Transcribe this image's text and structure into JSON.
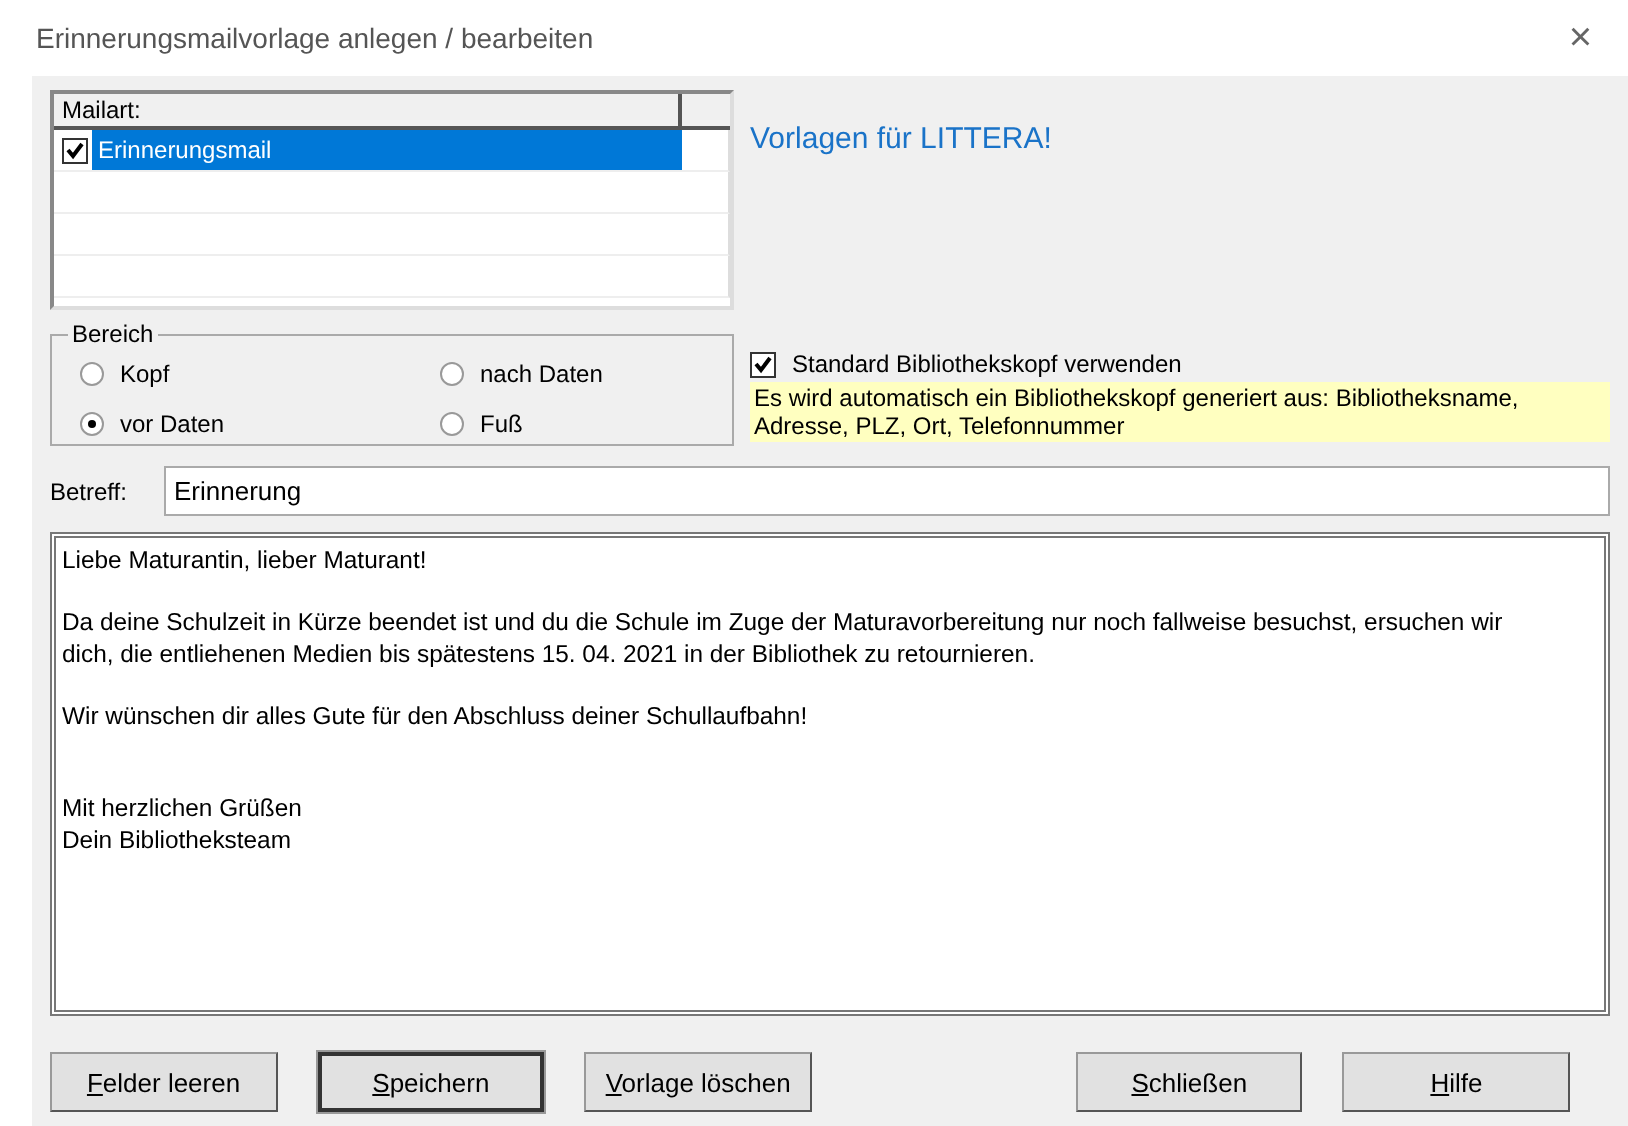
{
  "window": {
    "title": "Erinnerungsmailvorlage anlegen / bearbeiten",
    "close": "×"
  },
  "mail_types": {
    "column": "Mailart:",
    "rows": [
      {
        "label": "Erinnerungsmail",
        "checked": true,
        "selected": true
      }
    ]
  },
  "heading": "Vorlagen für LITTERA!",
  "bereich": {
    "title": "Bereich",
    "options": [
      {
        "label": "Kopf",
        "selected": false
      },
      {
        "label": "vor Daten",
        "selected": true
      },
      {
        "label": "nach Daten",
        "selected": false
      },
      {
        "label": "Fuß",
        "selected": false
      }
    ]
  },
  "standard_header": {
    "label": "Standard Bibliothekskopf verwenden",
    "checked": true
  },
  "note": "Es wird automatisch ein Bibliothekskopf generiert aus:   Bibliotheksname, Adresse, PLZ, Ort, Telefonnummer",
  "subject": {
    "label": "Betreff:",
    "value": "Erinnerung"
  },
  "body": "Liebe Maturantin, lieber Maturant!\n\nDa deine Schulzeit in Kürze beendet ist und du die Schule im Zuge der Maturavorbereitung nur noch fallweise besuchst, ersuchen wir dich, die entliehenen Medien bis spätestens 15. 04. 2021 in der Bibliothek zu retournieren.\n\nWir wünschen dir alles Gute für den Abschluss deiner Schullaufbahn!\n\n\nMit herzlichen Grüßen\nDein Bibliotheksteam",
  "buttons": [
    {
      "label": "Felder leeren",
      "default": false
    },
    {
      "label": "Speichern",
      "default": true
    },
    {
      "label": "Vorlage löschen",
      "default": false
    },
    {
      "label": "Schließen",
      "default": false
    },
    {
      "label": "Hilfe",
      "default": false
    }
  ]
}
